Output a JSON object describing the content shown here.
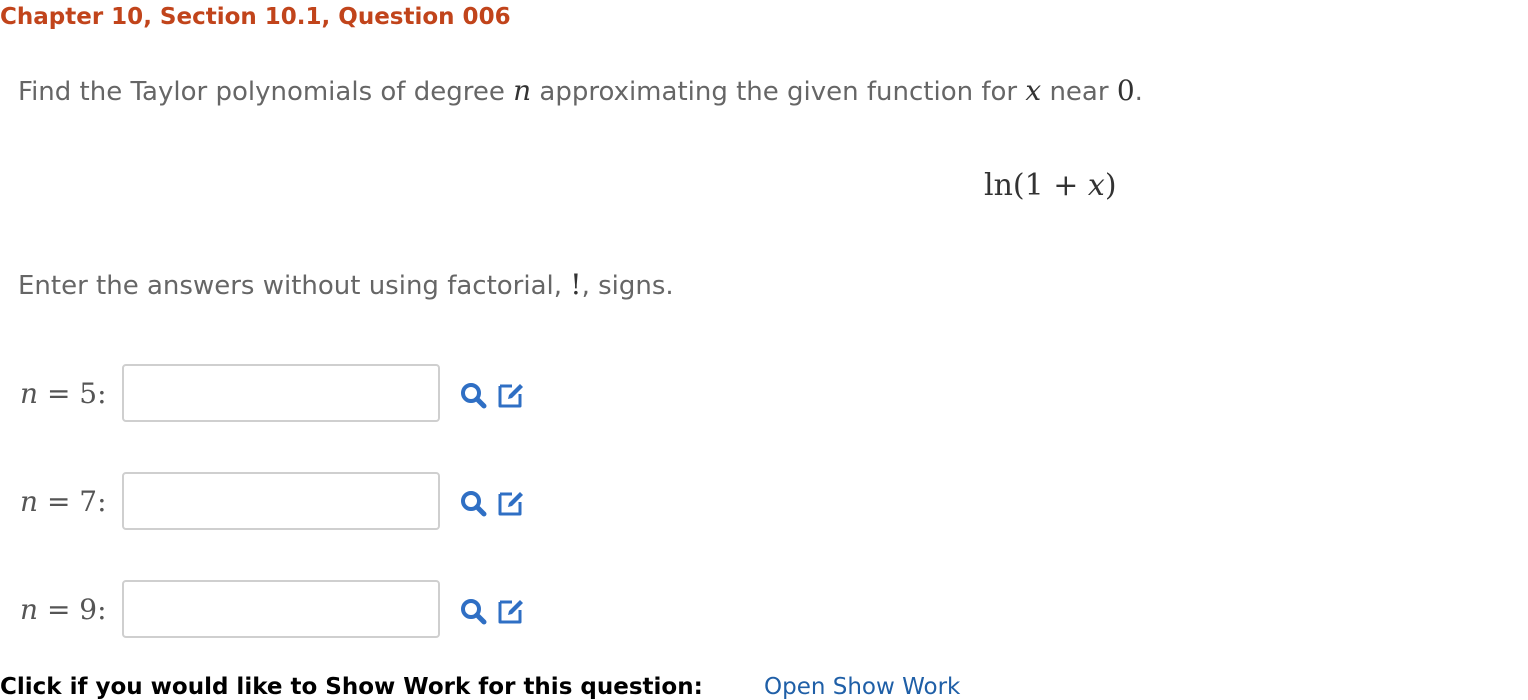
{
  "header": {
    "title": "Chapter 10, Section 10.1, Question 006"
  },
  "prompt": {
    "text_before_n": "Find the Taylor polynomials of degree ",
    "var_n": "n",
    "text_middle": " approximating the given function for ",
    "var_x": "x",
    "text_near": " near ",
    "value_zero": "0",
    "text_end": "."
  },
  "function": {
    "prefix": "ln(1 + ",
    "var": "x",
    "suffix": ")"
  },
  "instruction": {
    "text_before": "Enter the answers without using factorial, ",
    "bang": "!",
    "text_after": ", signs."
  },
  "answers": [
    {
      "var": "n",
      "label_rest": " = 5:",
      "value": ""
    },
    {
      "var": "n",
      "label_rest": " = 7:",
      "value": ""
    },
    {
      "var": "n",
      "label_rest": " = 9:",
      "value": ""
    }
  ],
  "icons": {
    "magnify": "magnifying-glass-icon",
    "edit": "edit-pencil-icon",
    "accent_color": "#2f6fc4"
  },
  "footer": {
    "prompt": "Click if you would like to Show Work for this question:",
    "link": "Open Show Work"
  },
  "colors": {
    "header": "#c1441b",
    "link": "#1f5fa7"
  }
}
